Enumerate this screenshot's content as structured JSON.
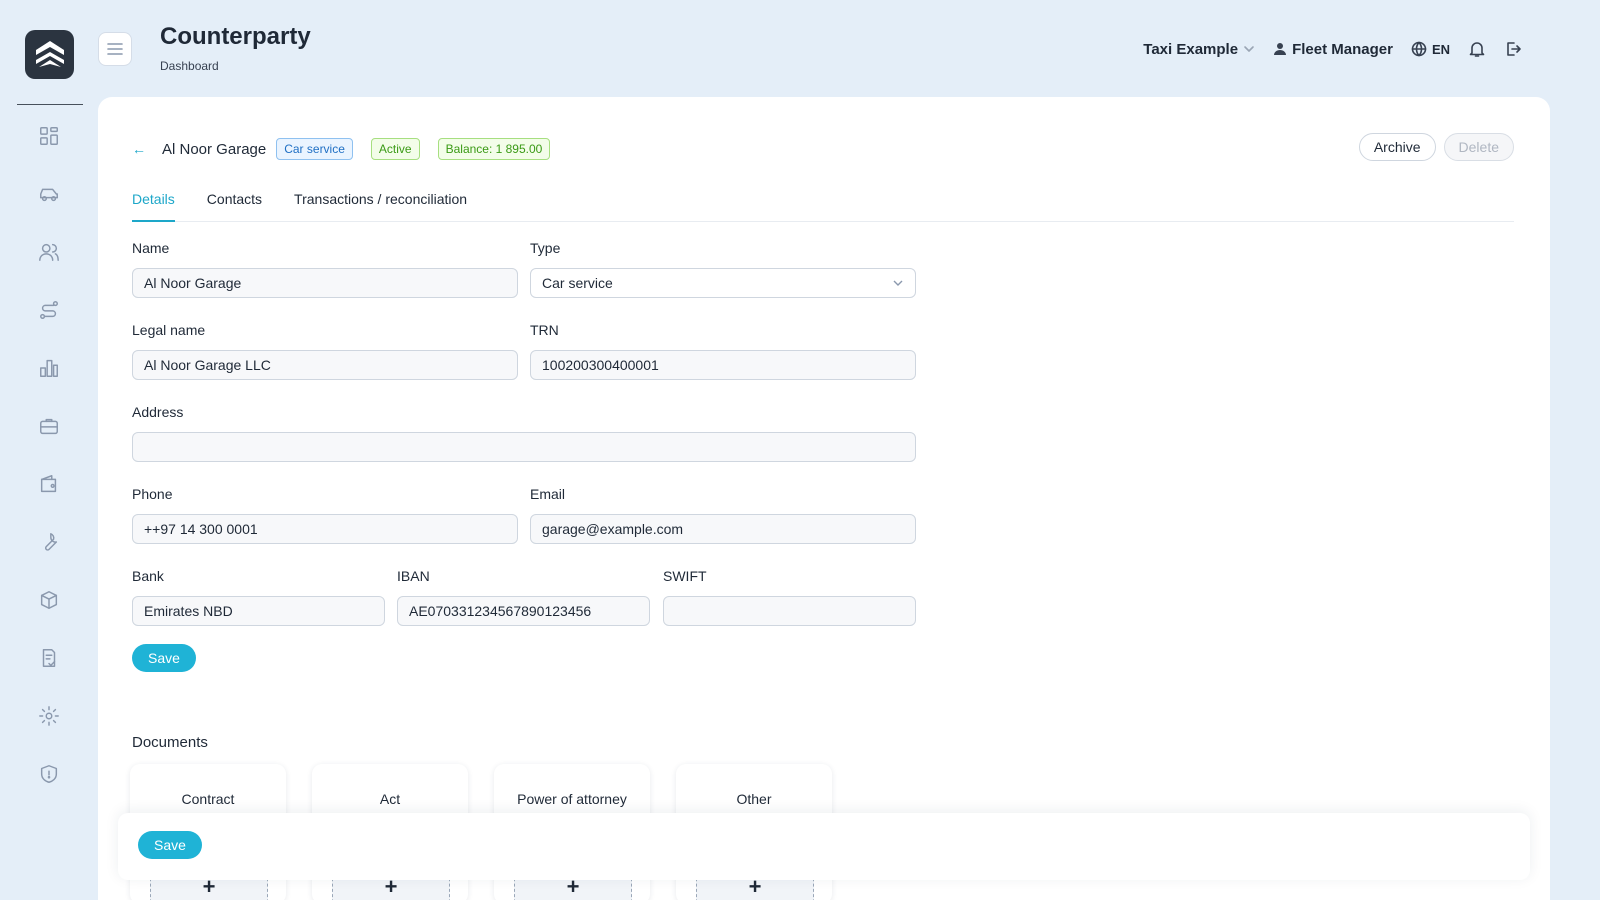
{
  "header": {
    "title": "Counterparty",
    "breadcrumb": "Dashboard",
    "company": "Taxi Example",
    "user": "Fleet Manager",
    "language": "EN"
  },
  "sidebar": {
    "items": [
      {
        "icon": "dashboard-icon"
      },
      {
        "icon": "car-icon"
      },
      {
        "icon": "users-icon"
      },
      {
        "icon": "route-icon"
      },
      {
        "icon": "chart-icon"
      },
      {
        "icon": "briefcase-icon"
      },
      {
        "icon": "wallet-icon"
      },
      {
        "icon": "wrench-icon"
      },
      {
        "icon": "box-icon"
      },
      {
        "icon": "checklist-icon"
      },
      {
        "icon": "gear-icon"
      },
      {
        "icon": "shield-icon"
      }
    ]
  },
  "entity": {
    "back": "←",
    "name": "Al Noor Garage",
    "type_badge": "Car service",
    "status_badge": "Active",
    "balance_badge": "Balance: 1 895.00"
  },
  "actions": {
    "archive": "Archive",
    "delete": "Delete"
  },
  "tabs": [
    {
      "label": "Details",
      "active": true
    },
    {
      "label": "Contacts",
      "active": false
    },
    {
      "label": "Transactions / reconciliation",
      "active": false
    }
  ],
  "form": {
    "name": {
      "label": "Name",
      "value": "Al Noor Garage"
    },
    "type": {
      "label": "Type",
      "value": "Car service"
    },
    "legal_name": {
      "label": "Legal name",
      "value": "Al Noor Garage LLC"
    },
    "trn": {
      "label": "TRN",
      "value": "100200300400001"
    },
    "address": {
      "label": "Address",
      "value": ""
    },
    "phone": {
      "label": "Phone",
      "value": "++97 14 300 0001"
    },
    "email": {
      "label": "Email",
      "value": "garage@example.com"
    },
    "bank": {
      "label": "Bank",
      "value": "Emirates NBD"
    },
    "iban": {
      "label": "IBAN",
      "value": "AE070331234567890123456"
    },
    "swift": {
      "label": "SWIFT",
      "value": ""
    },
    "save": "Save"
  },
  "documents": {
    "title": "Documents",
    "cards": [
      {
        "label": "Contract",
        "add": "+"
      },
      {
        "label": "Act",
        "add": "+"
      },
      {
        "label": "Power of attorney",
        "add": "+"
      },
      {
        "label": "Other",
        "add": "+"
      }
    ]
  },
  "sticky_bar": {
    "save": "Save"
  },
  "colors": {
    "accent": "#1fb3d6",
    "background": "#e4eef8",
    "success": "#3a9a15",
    "info": "#1f6fc4"
  }
}
